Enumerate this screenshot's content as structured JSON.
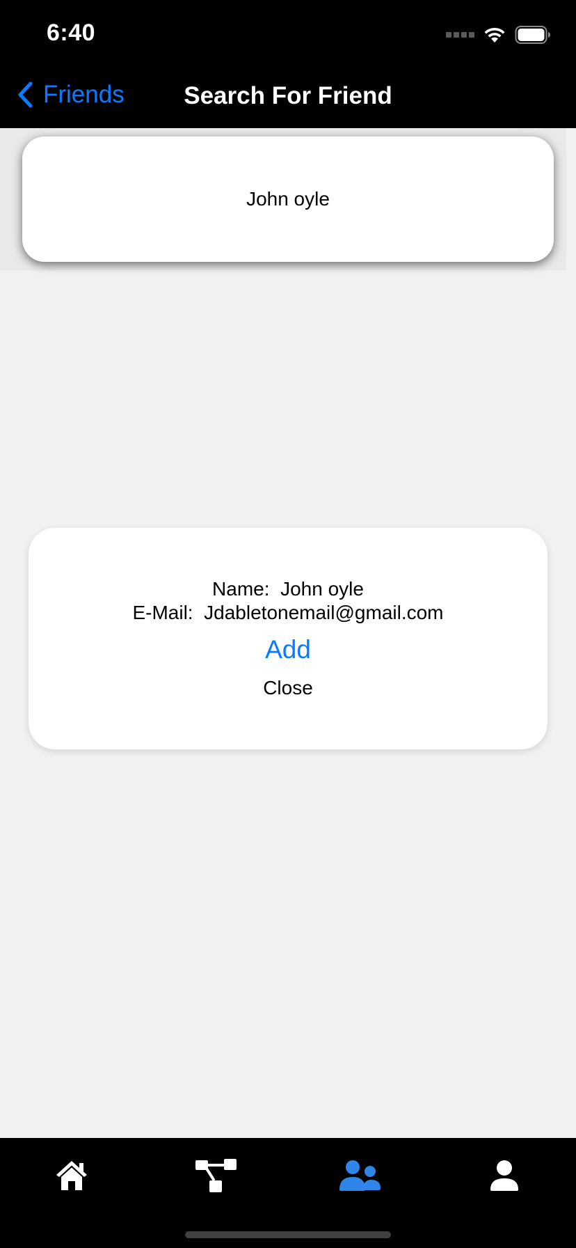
{
  "status_bar": {
    "time": "6:40"
  },
  "nav": {
    "back_label": "Friends",
    "title": "Search For Friend"
  },
  "search_results": [
    {
      "name": "John oyle"
    }
  ],
  "popup": {
    "name_label": "Name:",
    "name_value": "John oyle",
    "email_label": "E-Mail:",
    "email_value": "Jdabletonemail@gmail.com",
    "add_label": "Add",
    "close_label": "Close"
  },
  "tabbar": {
    "items": [
      {
        "icon": "home-icon",
        "selected": false
      },
      {
        "icon": "tree-icon",
        "selected": false
      },
      {
        "icon": "friends-icon",
        "selected": true
      },
      {
        "icon": "profile-icon",
        "selected": false
      }
    ]
  },
  "colors": {
    "accent": "#0a7aff",
    "header_bg": "#000000",
    "page_bg": "#f1f1f1",
    "card_bg": "#ffffff"
  }
}
